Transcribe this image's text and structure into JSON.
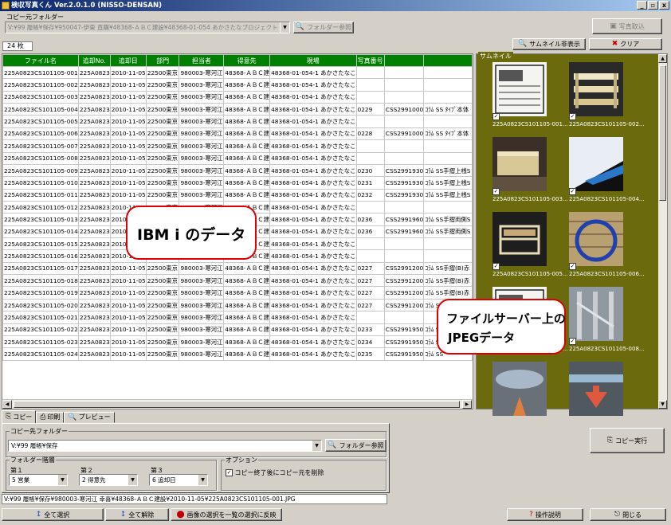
{
  "window": {
    "title": "検収写真くん Ver.2.0.1.0 (NISSO-DENSAN)",
    "min": "_",
    "max": "▫",
    "close": "x"
  },
  "copy_source": {
    "label": "コピー元フォルダー",
    "path": "V:¥99  履帳¥保存¥950047-伊東 直購¥48368-ＡＢＣ建設¥48368-01-054 あかさたなプロジェクト",
    "browse_label": "フォルダー参照"
  },
  "top_buttons": {
    "photo_fetch": "写真取込",
    "hide_thumbnails": "サムネイル非表示",
    "clear": "クリア"
  },
  "count": "24 枚",
  "grid": {
    "columns": [
      "ファイル名",
      "追却No.",
      "追却日",
      "部門",
      "担当者",
      "得意先",
      "現場",
      "写真番号",
      "",
      ""
    ],
    "rows": [
      [
        "225A0823CS101105-001",
        "225A0823",
        "2010-11-05",
        "22500東京",
        "980003-寒河江",
        "48368-ＡＢＣ建",
        "48368-01-054-1 あかさたなこ",
        "",
        "",
        ""
      ],
      [
        "225A0823CS101105-002",
        "225A0823",
        "2010-11-05",
        "22500東京",
        "980003-寒河江",
        "48368-ＡＢＣ建",
        "48368-01-054-1 あかさたなこ",
        "",
        "",
        ""
      ],
      [
        "225A0823CS101105-003",
        "225A0823",
        "2010-11-05",
        "22500東京",
        "980003-寒河江",
        "48368-ＡＢＣ建",
        "48368-01-054-1 あかさたなこ",
        "",
        "",
        ""
      ],
      [
        "225A0823CS101105-004",
        "225A0823",
        "2010-11-05",
        "22500東京",
        "980003-寒河江",
        "48368-ＡＢＣ建",
        "48368-01-054-1 あかさたなこ",
        "0229",
        "CSS2991000",
        "ｺﾗﾑ SS ﾀｲﾌﾟ本体"
      ],
      [
        "225A0823CS101105-005",
        "225A0823",
        "2010-11-05",
        "22500東京",
        "980003-寒河江",
        "48368-ＡＢＣ建",
        "48368-01-054-1 あかさたなこ",
        "",
        "",
        ""
      ],
      [
        "225A0823CS101105-006",
        "225A0823",
        "2010-11-05",
        "22500東京",
        "980003-寒河江",
        "48368-ＡＢＣ建",
        "48368-01-054-1 あかさたなこ",
        "0228",
        "CSS2991000",
        "ｺﾗﾑ SS ﾀｲﾌﾟ本体"
      ],
      [
        "225A0823CS101105-007",
        "225A0823",
        "2010-11-05",
        "22500東京",
        "980003-寒河江",
        "48368-ＡＢＣ建",
        "48368-01-054-1 あかさたなこ",
        "",
        "",
        ""
      ],
      [
        "225A0823CS101105-008",
        "225A0823",
        "2010-11-05",
        "22500東京",
        "980003-寒河江",
        "48368-ＡＢＣ建",
        "48368-01-054-1 あかさたなこ",
        "",
        "",
        ""
      ],
      [
        "225A0823CS101105-009",
        "225A0823",
        "2010-11-05",
        "22500東京",
        "980003-寒河江",
        "48368-ＡＢＣ建",
        "48368-01-054-1 あかさたなこ",
        "0230",
        "CSS2991930",
        "ｺﾗﾑ SS手摺上桟S"
      ],
      [
        "225A0823CS101105-010",
        "225A0823",
        "2010-11-05",
        "22500東京",
        "980003-寒河江",
        "48368-ＡＢＣ建",
        "48368-01-054-1 あかさたなこ",
        "0231",
        "CSS2991930",
        "ｺﾗﾑ SS手摺上桟S"
      ],
      [
        "225A0823CS101105-011",
        "225A0823",
        "2010-11-05",
        "22500東京",
        "980003-寒河江",
        "48368-ＡＢＣ建",
        "48368-01-054-1 あかさたなこ",
        "0232",
        "CSS2991930",
        "ｺﾗﾑ SS手摺上桟S"
      ],
      [
        "225A0823CS101105-012",
        "225A0823",
        "2010-11-05",
        "22500東京",
        "980003-寒河江",
        "48368-ＡＢＣ建",
        "48368-01-054-1 あかさたなこ",
        "",
        "",
        ""
      ],
      [
        "225A0823CS101105-013",
        "225A0823",
        "2010-11-05",
        "22500東京",
        "980003-寒河江",
        "48368-ＡＢＣ建",
        "48368-01-054-1 あかさたなこ",
        "0236",
        "CSS2991960",
        "ｺﾗﾑ SS手摺両側S"
      ],
      [
        "225A0823CS101105-014",
        "225A0823",
        "2010-11-05",
        "22500東京",
        "980003-寒河江",
        "48368-ＡＢＣ建",
        "48368-01-054-1 あかさたなこ",
        "0236",
        "CSS2991960",
        "ｺﾗﾑ SS手摺両側S"
      ],
      [
        "225A0823CS101105-015",
        "225A0823",
        "2010-11-05",
        "22500東京",
        "980003-寒河江",
        "48368-ＡＢＣ建",
        "48368-01-054-1 あかさたなこ",
        "",
        "",
        ""
      ],
      [
        "225A0823CS101105-016",
        "225A0823",
        "2010-11-05",
        "22500東京",
        "980003-寒河江",
        "48368-ＡＢＣ建",
        "48368-01-054-1 あかさたなこ",
        "",
        "",
        ""
      ],
      [
        "225A0823CS101105-017",
        "225A0823",
        "2010-11-05",
        "22500東京",
        "980003-寒河江",
        "48368-ＡＢＣ建",
        "48368-01-054-1 あかさたなこ",
        "0227",
        "CSS2991200",
        "ｺﾗﾑ SS手摺(B)赤"
      ],
      [
        "225A0823CS101105-018",
        "225A0823",
        "2010-11-05",
        "22500東京",
        "980003-寒河江",
        "48368-ＡＢＣ建",
        "48368-01-054-1 あかさたなこ",
        "0227",
        "CSS2991200",
        "ｺﾗﾑ SS手摺(B)赤"
      ],
      [
        "225A0823CS101105-019",
        "225A0823",
        "2010-11-05",
        "22500東京",
        "980003-寒河江",
        "48368-ＡＢＣ建",
        "48368-01-054-1 あかさたなこ",
        "0227",
        "CSS2991200",
        "ｺﾗﾑ SS手摺(B)赤"
      ],
      [
        "225A0823CS101105-020",
        "225A0823",
        "2010-11-05",
        "22500東京",
        "980003-寒河江",
        "48368-ＡＢＣ建",
        "48368-01-054-1 あかさたなこ",
        "0227",
        "CSS2991200",
        "ｺﾗﾑ SS手摺(B)赤"
      ],
      [
        "225A0823CS101105-021",
        "225A0823",
        "2010-11-05",
        "22500東京",
        "980003-寒河江",
        "48368-ＡＢＣ建",
        "48368-01-054-1 あかさたなこ",
        "",
        "",
        ""
      ],
      [
        "225A0823CS101105-022",
        "225A0823",
        "2010-11-05",
        "22500東京",
        "980003-寒河江",
        "48368-ＡＢＣ建",
        "48368-01-054-1 あかさたなこ",
        "0233",
        "CSS2991950",
        "ｺﾗﾑ SS"
      ],
      [
        "225A0823CS101105-023",
        "225A0823",
        "2010-11-05",
        "22500東京",
        "980003-寒河江",
        "48368-ＡＢＣ建",
        "48368-01-054-1 あかさたなこ",
        "0234",
        "CSS2991950",
        "ｺﾗﾑ SS"
      ],
      [
        "225A0823CS101105-024",
        "225A0823",
        "2010-11-05",
        "22500東京",
        "980003-寒河江",
        "48368-ＡＢＣ建",
        "48368-01-054-1 あかさたなこ",
        "0235",
        "CSS2991950",
        "ｺﾗﾑ SS"
      ]
    ]
  },
  "thumbnails": {
    "label": "サムネイル",
    "items": [
      {
        "caption": "225A0823CS101105-001...",
        "kind": "doc",
        "checked": true
      },
      {
        "caption": "225A0823CS101105-002...",
        "kind": "shelf",
        "checked": true
      },
      {
        "caption": "225A0823CS101105-003...",
        "kind": "box",
        "checked": true
      },
      {
        "caption": "225A0823CS101105-004...",
        "kind": "sky",
        "checked": true
      },
      {
        "caption": "225A0823CS101105-005...",
        "kind": "rack",
        "checked": true
      },
      {
        "caption": "225A0823CS101105-006...",
        "kind": "ring",
        "checked": true
      },
      {
        "caption": "225A0823CS101105-007...",
        "kind": "doc",
        "checked": true
      },
      {
        "caption": "225A0823CS101105-008...",
        "kind": "metal",
        "checked": true
      },
      {
        "caption": "",
        "kind": "pipe",
        "checked": false
      },
      {
        "caption": "",
        "kind": "arrow",
        "checked": false
      }
    ]
  },
  "callouts": {
    "ibm": "IBM i のデータ",
    "jpeg_line1": "ファイルサーバー上の",
    "jpeg_line2": "JPEGデータ"
  },
  "tabs": [
    {
      "label": "コピー",
      "icon": "copy-icon"
    },
    {
      "label": "印刷",
      "icon": "print-icon"
    },
    {
      "label": "プレビュー",
      "icon": "preview-icon"
    }
  ],
  "copy_tab": {
    "dest_label": "コピー先フォルダー",
    "dest_path": "V:¥99  履帳¥保存",
    "browse_label": "フォルダー参照",
    "hierarchy_label": "フォルダー階層",
    "level1_label": "第１",
    "level1_value": "5 営業",
    "level2_label": "第２",
    "level2_value": "2 得意先",
    "level3_label": "第３",
    "level3_value": "6 追却日",
    "options_label": "オプション",
    "option_delete": "コピー終了後にコピー元を削除",
    "option_delete_checked": true
  },
  "execute_copy": "コピー実行",
  "status": "V:¥99  履帳¥保存¥980003-寒河江  幸喜¥48368-ＡＢＣ建設¥2010-11-05¥225A0823CS101105-001.JPG",
  "bottom": {
    "select_all": "全て選択",
    "deselect_all": "全て解除",
    "reflect": "画像の選択を一覧の選択に反映",
    "help": "操作説明",
    "close": "閉じる"
  },
  "colors": {
    "grid_header": "#008000",
    "thumb_bg": "#6b6b0d",
    "callout_border": "#e00000"
  }
}
